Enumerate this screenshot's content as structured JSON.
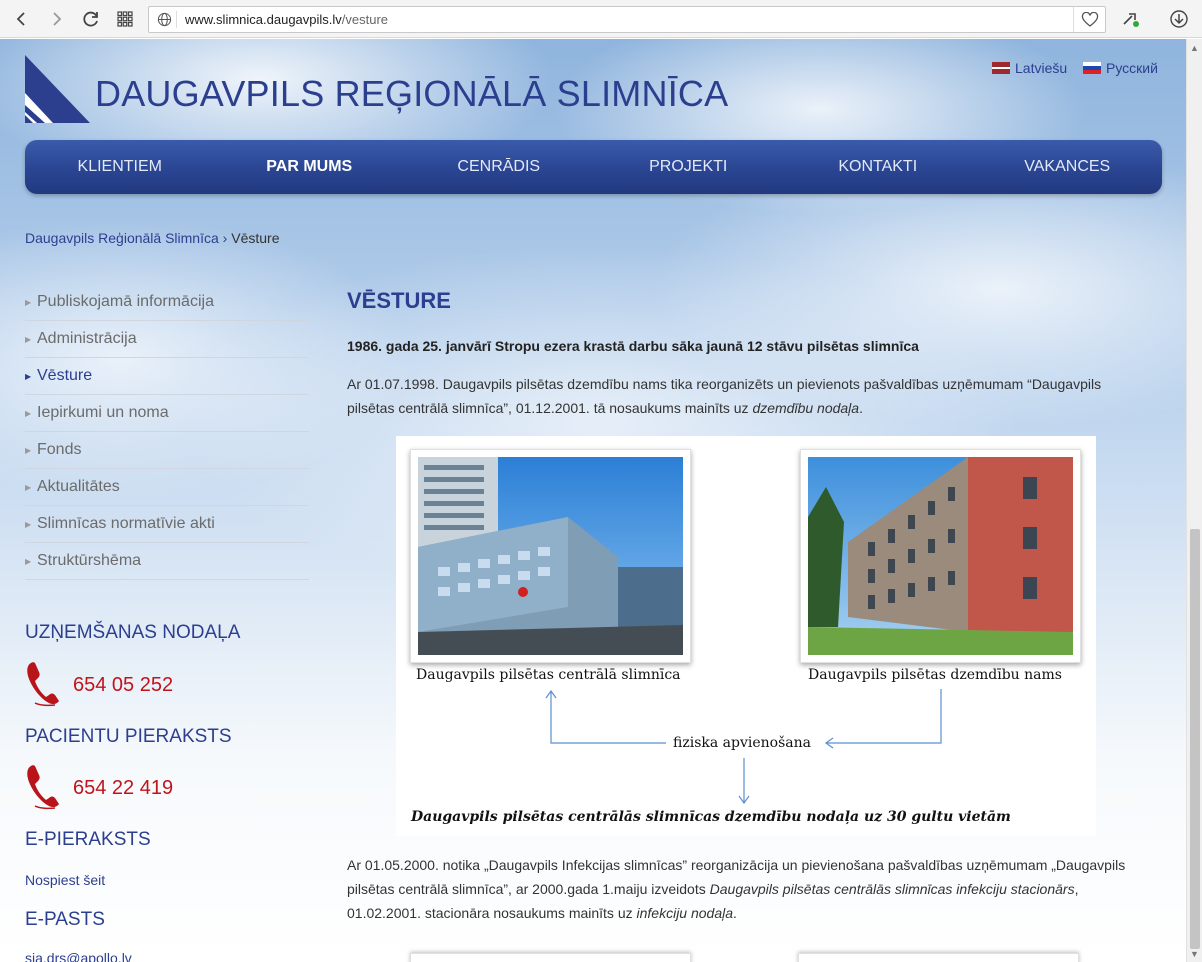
{
  "browser": {
    "url_host": "www.slimnica.daugavpils.lv",
    "url_path": "/vesture"
  },
  "header": {
    "site_title": "DAUGAVPILS REĢIONĀLĀ SLIMNĪCA",
    "lang_lv": "Latviešu",
    "lang_ru": "Русский"
  },
  "menu": [
    {
      "label": "KLIENTIEM"
    },
    {
      "label": "PAR MUMS"
    },
    {
      "label": "CENRĀDIS"
    },
    {
      "label": "PROJEKTI"
    },
    {
      "label": "KONTAKTI"
    },
    {
      "label": "VAKANCES"
    }
  ],
  "breadcrumb": {
    "home": "Daugavpils Reģionālā Slimnīca",
    "separator": " › ",
    "current": "Vēsture"
  },
  "sidebar": {
    "items": [
      {
        "label": "Publiskojamā informācija"
      },
      {
        "label": "Administrācija"
      },
      {
        "label": "Vēsture"
      },
      {
        "label": "Iepirkumi un noma"
      },
      {
        "label": "Fonds"
      },
      {
        "label": "Aktualitātes"
      },
      {
        "label": "Slimnīcas normatīvie akti"
      },
      {
        "label": "Struktūrshēma"
      }
    ],
    "reception_heading": "UZŅEMŠANAS NODAĻA",
    "reception_phone": "654 05 252",
    "appointments_heading": "PACIENTU PIERAKSTS",
    "appointments_phone": "654 22 419",
    "eappointments_heading": "E-PIERAKSTS",
    "eappointments_link": "Nospiest šeit",
    "email_heading": "E-PASTS",
    "email_value": "sia.drs@apollo.lv"
  },
  "main": {
    "title": "VĒSTURE",
    "lead": "1986. gada 25. janvārī Stropu ezera krastā darbu sāka jaunā 12 stāvu pilsētas slimnīca",
    "para1_a": "Ar 01.07.1998. Daugavpils pilsētas dzemdību nams tika reorganizēts un pievienots pašvaldības uzņēmumam “Daugavpils pilsētas centrālā slimnīca”, 01.12.2001. tā nosaukums mainīts uz ",
    "para1_em": "dzemdību nodaļa",
    "para1_b": ".",
    "diagram": {
      "caption_left": "Daugavpils pilsētas centrālā slimnīca",
      "caption_right": "Daugavpils pilsētas dzemdību nams",
      "merge_label": "fiziska apvienošana",
      "result": "Daugavpils pilsētas centrālās slimnīcas dzemdību nodaļa uz 30 gultu vietām"
    },
    "para2_a": "Ar 01.05.2000. notika „Daugavpils Infekcijas slimnīcas” reorganizācija un pievienošana pašvaldības uzņēmumam „Daugavpils pilsētas centrālā slimnīca”, ar 2000.gada 1.maiju izveidots ",
    "para2_em1": "Daugavpils pilsētas centrālās slimnīcas infekciju stacionārs",
    "para2_b": ", 01.02.2001. stacionāra nosaukums mainīts uz ",
    "para2_em2": "infekciju nodaļa",
    "para2_c": "."
  },
  "colors": {
    "brand_blue": "#2c3f8f",
    "phone_red": "#c0141b"
  }
}
